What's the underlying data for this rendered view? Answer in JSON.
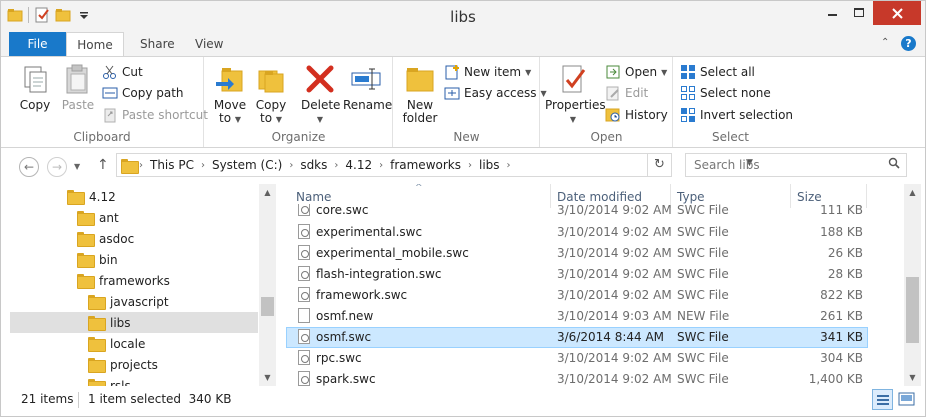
{
  "window": {
    "title": "libs"
  },
  "tabs": {
    "file": "File",
    "home": "Home",
    "share": "Share",
    "view": "View"
  },
  "ribbon": {
    "clipboard": {
      "label": "Clipboard",
      "copy": "Copy",
      "paste": "Paste",
      "cut": "Cut",
      "copy_path": "Copy path",
      "paste_shortcut": "Paste shortcut"
    },
    "organize": {
      "label": "Organize",
      "move_to_1": "Move",
      "move_to_2": "to",
      "copy_to_1": "Copy",
      "copy_to_2": "to",
      "delete": "Delete",
      "rename": "Rename"
    },
    "new": {
      "label": "New",
      "new_folder_1": "New",
      "new_folder_2": "folder",
      "new_item": "New item",
      "easy_access": "Easy access"
    },
    "open": {
      "label": "Open",
      "properties": "Properties",
      "open": "Open",
      "edit": "Edit",
      "history": "History"
    },
    "select": {
      "label": "Select",
      "select_all": "Select all",
      "select_none": "Select none",
      "invert_selection": "Invert selection"
    }
  },
  "address": {
    "crumbs": [
      "This PC",
      "System (C:)",
      "sdks",
      "4.12",
      "frameworks",
      "libs"
    ],
    "search_placeholder": "Search libs"
  },
  "nav_tree": [
    {
      "label": "4.12"
    },
    {
      "label": "ant"
    },
    {
      "label": "asdoc"
    },
    {
      "label": "bin"
    },
    {
      "label": "frameworks"
    },
    {
      "label": "javascript"
    },
    {
      "label": "libs"
    },
    {
      "label": "locale"
    },
    {
      "label": "projects"
    },
    {
      "label": "rsls"
    }
  ],
  "columns": {
    "name": "Name",
    "date": "Date modified",
    "type": "Type",
    "size": "Size"
  },
  "files": [
    {
      "name": "core.swc",
      "date": "3/10/2014 9:02 AM",
      "type": "SWC File",
      "size": "111 KB"
    },
    {
      "name": "experimental.swc",
      "date": "3/10/2014 9:02 AM",
      "type": "SWC File",
      "size": "188 KB"
    },
    {
      "name": "experimental_mobile.swc",
      "date": "3/10/2014 9:02 AM",
      "type": "SWC File",
      "size": "26 KB"
    },
    {
      "name": "flash-integration.swc",
      "date": "3/10/2014 9:02 AM",
      "type": "SWC File",
      "size": "28 KB"
    },
    {
      "name": "framework.swc",
      "date": "3/10/2014 9:02 AM",
      "type": "SWC File",
      "size": "822 KB"
    },
    {
      "name": "osmf.new",
      "date": "3/10/2014 9:03 AM",
      "type": "NEW File",
      "size": "261 KB"
    },
    {
      "name": "osmf.swc",
      "date": "3/6/2014 8:44 AM",
      "type": "SWC File",
      "size": "341 KB"
    },
    {
      "name": "rpc.swc",
      "date": "3/10/2014 9:02 AM",
      "type": "SWC File",
      "size": "304 KB"
    },
    {
      "name": "spark.swc",
      "date": "3/10/2014 9:02 AM",
      "type": "SWC File",
      "size": "1,400 KB"
    }
  ],
  "status": {
    "items": "21 items",
    "selected": "1 item selected  340 KB"
  },
  "colors": {
    "accent": "#1979ca",
    "selection": "#cce8ff",
    "folder": "#efc13d",
    "close": "#c7392a"
  }
}
